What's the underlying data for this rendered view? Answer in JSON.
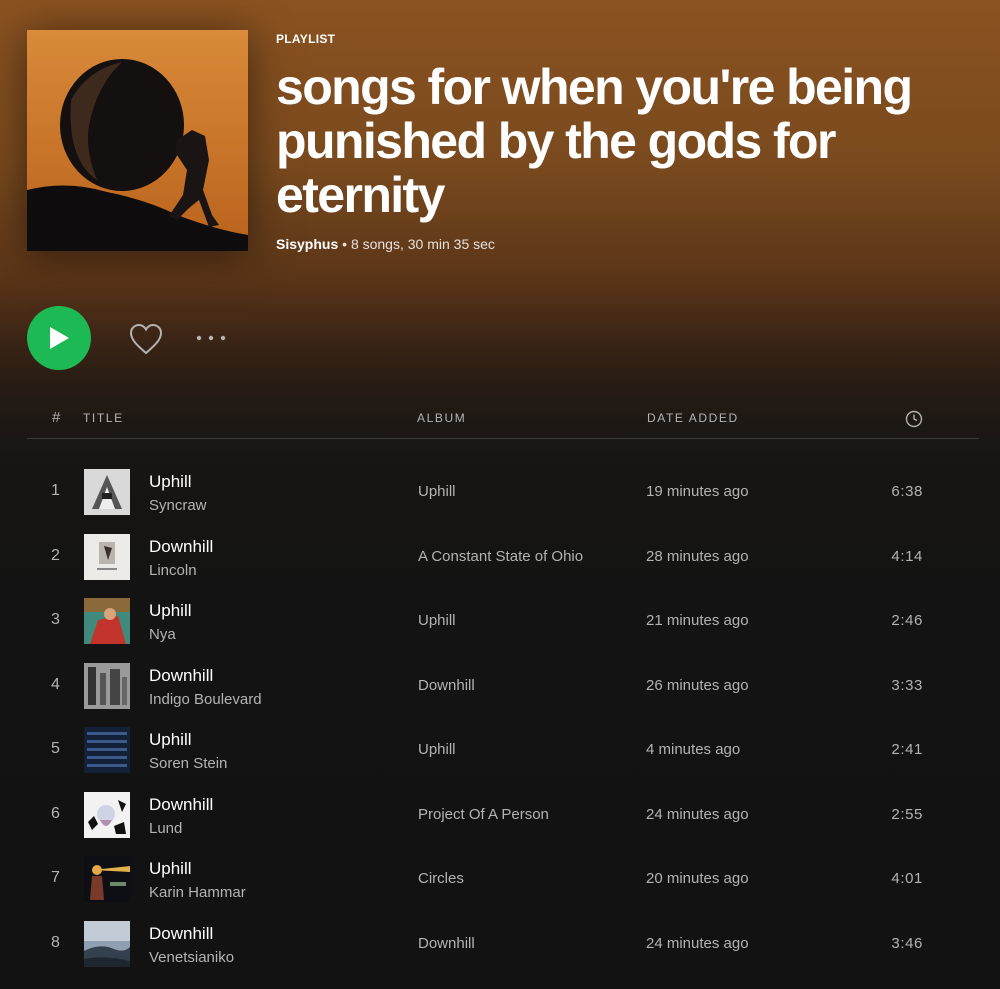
{
  "playlist": {
    "label": "PLAYLIST",
    "title": "songs for when you're being punished by the gods for eternity",
    "owner": "Sisyphus",
    "separator": " • ",
    "summary": "8 songs, 30 min 35 sec"
  },
  "controls": {
    "play_icon": "play-icon",
    "like_icon": "heart-icon",
    "more_icon": "more-icon",
    "accent": "#1db954"
  },
  "table": {
    "headers": {
      "num": "#",
      "title": "TITLE",
      "album": "ALBUM",
      "date_added": "DATE ADDED",
      "duration_icon": "clock-icon"
    },
    "tracks": [
      {
        "n": "1",
        "title": "Uphill",
        "artist": "Syncraw",
        "album": "Uphill",
        "added": "19 minutes ago",
        "duration": "6:38"
      },
      {
        "n": "2",
        "title": "Downhill",
        "artist": "Lincoln",
        "album": "A Constant State of Ohio",
        "added": "28 minutes ago",
        "duration": "4:14"
      },
      {
        "n": "3",
        "title": "Uphill",
        "artist": "Nya",
        "album": "Uphill",
        "added": "21 minutes ago",
        "duration": "2:46"
      },
      {
        "n": "4",
        "title": "Downhill",
        "artist": "Indigo Boulevard",
        "album": "Downhill",
        "added": "26 minutes ago",
        "duration": "3:33"
      },
      {
        "n": "5",
        "title": "Uphill",
        "artist": "Soren Stein",
        "album": "Uphill",
        "added": "4 minutes ago",
        "duration": "2:41"
      },
      {
        "n": "6",
        "title": "Downhill",
        "artist": "Lund",
        "album": "Project Of A Person",
        "added": "24 minutes ago",
        "duration": "2:55"
      },
      {
        "n": "7",
        "title": "Uphill",
        "artist": "Karin Hammar",
        "album": "Circles",
        "added": "20 minutes ago",
        "duration": "4:01"
      },
      {
        "n": "8",
        "title": "Downhill",
        "artist": "Venetsianiko",
        "album": "Downhill",
        "added": "24 minutes ago",
        "duration": "3:46"
      }
    ]
  }
}
